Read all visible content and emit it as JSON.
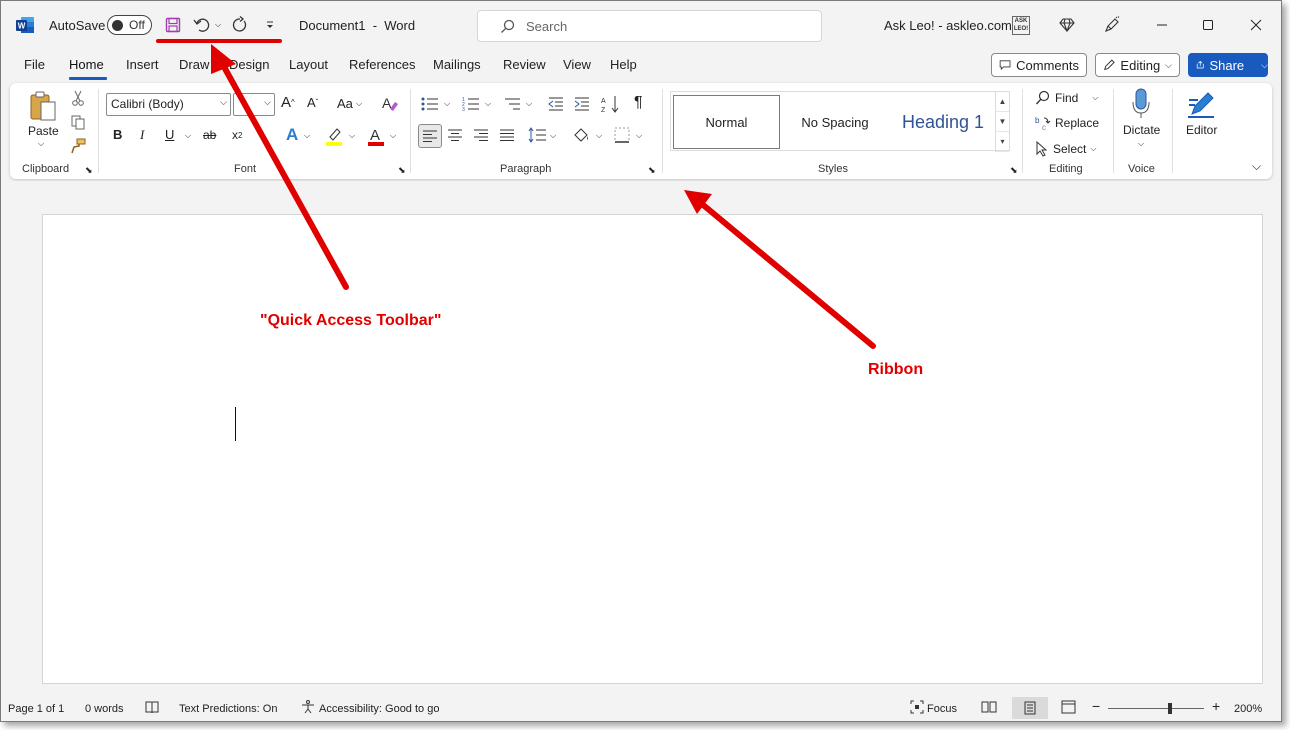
{
  "titlebar": {
    "autosave_label": "AutoSave",
    "autosave_state": "Off",
    "document_title": "Document1  -  Word",
    "search_placeholder": "Search",
    "user_name": "Ask Leo! - askleo.com",
    "avatar_text": "ASK LEO!"
  },
  "tabs": [
    "File",
    "Home",
    "Insert",
    "Draw",
    "Design",
    "Layout",
    "References",
    "Mailings",
    "Review",
    "View",
    "Help"
  ],
  "active_tab": "Home",
  "header_buttons": {
    "comments": "Comments",
    "editing": "Editing",
    "share": "Share"
  },
  "ribbon": {
    "clipboard": {
      "paste": "Paste",
      "label": "Clipboard"
    },
    "font": {
      "name": "Calibri (Body)",
      "size": "",
      "label": "Font",
      "change_case": "Aa"
    },
    "paragraph": {
      "label": "Paragraph"
    },
    "styles": {
      "items": [
        "Normal",
        "No Spacing",
        "Heading 1"
      ],
      "label": "Styles"
    },
    "editing": {
      "find": "Find",
      "replace": "Replace",
      "select": "Select",
      "label": "Editing"
    },
    "voice": {
      "dictate": "Dictate",
      "label": "Voice"
    },
    "editor": {
      "label": "Editor"
    }
  },
  "statusbar": {
    "page": "Page 1 of 1",
    "words": "0 words",
    "text_predictions": "Text Predictions: On",
    "accessibility": "Accessibility: Good to go",
    "focus": "Focus",
    "zoom": "200%"
  },
  "annotations": {
    "qat": "\"Quick Access Toolbar\"",
    "ribbon": "Ribbon"
  },
  "colors": {
    "accent": "#185abd",
    "annotation_red": "#e10000",
    "save_icon_purple": "#a43bb6"
  }
}
